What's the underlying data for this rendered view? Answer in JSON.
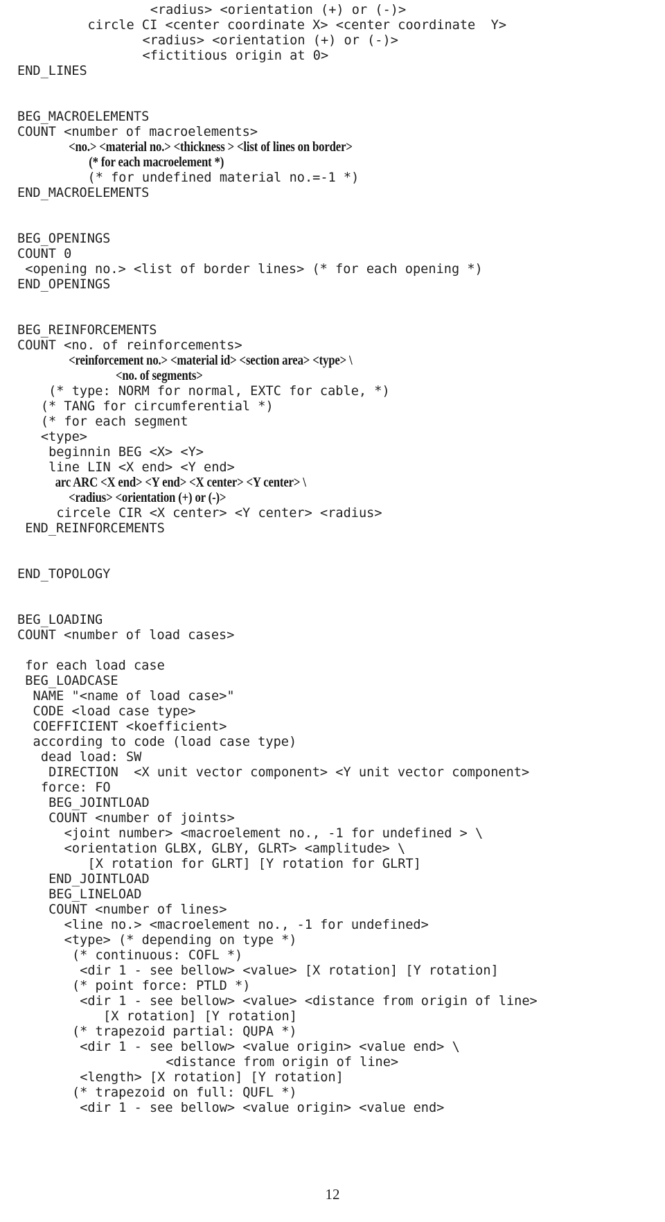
{
  "document": {
    "page_number": "12",
    "lines": [
      {
        "indent": 17,
        "text": "<radius> <orientation (+) or (-)>",
        "style": "mono"
      },
      {
        "indent": 9,
        "text": "circle CI <center coordinate X> <center coordinate  Y>",
        "style": "mono"
      },
      {
        "indent": 16,
        "text": "<radius> <orientation (+) or (-)>",
        "style": "mono"
      },
      {
        "indent": 16,
        "text": "<fictitious origin at 0>",
        "style": "mono"
      },
      {
        "indent": 0,
        "text": "END_LINES",
        "style": "mono"
      },
      {
        "indent": 0,
        "text": "",
        "style": "blank"
      },
      {
        "indent": 0,
        "text": "",
        "style": "blank"
      },
      {
        "indent": 0,
        "text": "BEG_MACROELEMENTS",
        "style": "mono"
      },
      {
        "indent": 0,
        "text": "COUNT <number of macroelements>",
        "style": "mono"
      },
      {
        "indent": 8,
        "text": "<no.> <material no.> <thickness > <list of lines on border>",
        "style": "serif"
      },
      {
        "indent": 11,
        "text": "(* for each macroelement *)",
        "style": "serif"
      },
      {
        "indent": 9,
        "text": "(* for undefined material no.=-1 *)",
        "style": "mono"
      },
      {
        "indent": 0,
        "text": "END_MACROELEMENTS",
        "style": "mono"
      },
      {
        "indent": 0,
        "text": "",
        "style": "blank"
      },
      {
        "indent": 0,
        "text": "",
        "style": "blank"
      },
      {
        "indent": 0,
        "text": "BEG_OPENINGS",
        "style": "mono"
      },
      {
        "indent": 0,
        "text": "COUNT 0",
        "style": "mono"
      },
      {
        "indent": 1,
        "text": "<opening no.> <list of border lines> (* for each opening *)",
        "style": "mono"
      },
      {
        "indent": 0,
        "text": "END_OPENINGS",
        "style": "mono"
      },
      {
        "indent": 0,
        "text": "",
        "style": "blank"
      },
      {
        "indent": 0,
        "text": "",
        "style": "blank"
      },
      {
        "indent": 0,
        "text": "BEG_REINFORCEMENTS",
        "style": "mono"
      },
      {
        "indent": 0,
        "text": "COUNT <no. of reinforcements>",
        "style": "mono"
      },
      {
        "indent": 8,
        "text": "<reinforcement no.> <material id> <section area> <type> \\",
        "style": "serif"
      },
      {
        "indent": 15,
        "text": "<no. of segments>",
        "style": "serif"
      },
      {
        "indent": 4,
        "text": "(* type: NORM for normal, EXTC for cable, *)",
        "style": "mono"
      },
      {
        "indent": 3,
        "text": "(* TANG for circumferential *)",
        "style": "mono"
      },
      {
        "indent": 3,
        "text": "(* for each segment",
        "style": "mono"
      },
      {
        "indent": 3,
        "text": "<type>",
        "style": "mono"
      },
      {
        "indent": 4,
        "text": "beginnin BEG <X> <Y>",
        "style": "mono"
      },
      {
        "indent": 4,
        "text": "line LIN <X end> <Y end>",
        "style": "mono"
      },
      {
        "indent": 6,
        "text": "arc ARC <X end> <Y end> <X center> <Y center> \\",
        "style": "serif"
      },
      {
        "indent": 8,
        "text": "<radius> <orientation (+) or (-)>",
        "style": "serif"
      },
      {
        "indent": 5,
        "text": "circele CIR <X center> <Y center> <radius>",
        "style": "mono"
      },
      {
        "indent": 1,
        "text": "END_REINFORCEMENTS",
        "style": "mono"
      },
      {
        "indent": 0,
        "text": "",
        "style": "blank"
      },
      {
        "indent": 0,
        "text": "",
        "style": "blank"
      },
      {
        "indent": 0,
        "text": "END_TOPOLOGY",
        "style": "mono"
      },
      {
        "indent": 0,
        "text": "",
        "style": "blank"
      },
      {
        "indent": 0,
        "text": "",
        "style": "blank"
      },
      {
        "indent": 0,
        "text": "BEG_LOADING",
        "style": "mono"
      },
      {
        "indent": 0,
        "text": "COUNT <number of load cases>",
        "style": "mono"
      },
      {
        "indent": 0,
        "text": "",
        "style": "blank"
      },
      {
        "indent": 1,
        "text": "for each load case",
        "style": "mono"
      },
      {
        "indent": 1,
        "text": "BEG_LOADCASE",
        "style": "mono"
      },
      {
        "indent": 2,
        "text": "NAME \"<name of load case>\"",
        "style": "mono"
      },
      {
        "indent": 2,
        "text": "CODE <load case type>",
        "style": "mono"
      },
      {
        "indent": 2,
        "text": "COEFFICIENT <koefficient>",
        "style": "mono"
      },
      {
        "indent": 2,
        "text": "according to code (load case type)",
        "style": "mono"
      },
      {
        "indent": 3,
        "text": "dead load: SW",
        "style": "mono"
      },
      {
        "indent": 4,
        "text": "DIRECTION  <X unit vector component> <Y unit vector component>",
        "style": "mono"
      },
      {
        "indent": 3,
        "text": "force: FO",
        "style": "mono"
      },
      {
        "indent": 4,
        "text": "BEG_JOINTLOAD",
        "style": "mono"
      },
      {
        "indent": 4,
        "text": "COUNT <number of joints>",
        "style": "mono"
      },
      {
        "indent": 6,
        "text": "<joint number> <macroelement no., -1 for undefined > \\",
        "style": "mono"
      },
      {
        "indent": 6,
        "text": "<orientation GLBX, GLBY, GLRT> <amplitude> \\",
        "style": "mono"
      },
      {
        "indent": 9,
        "text": "[X rotation for GLRT] [Y rotation for GLRT]",
        "style": "mono"
      },
      {
        "indent": 4,
        "text": "END_JOINTLOAD",
        "style": "mono"
      },
      {
        "indent": 4,
        "text": "BEG_LINELOAD",
        "style": "mono"
      },
      {
        "indent": 4,
        "text": "COUNT <number of lines>",
        "style": "mono"
      },
      {
        "indent": 6,
        "text": "<line no.> <macroelement no., -1 for undefined>",
        "style": "mono"
      },
      {
        "indent": 6,
        "text": "<type> (* depending on type *)",
        "style": "mono"
      },
      {
        "indent": 7,
        "text": "(* continuous: COFL *)",
        "style": "mono"
      },
      {
        "indent": 8,
        "text": "<dir 1 - see bellow> <value> [X rotation] [Y rotation]",
        "style": "mono"
      },
      {
        "indent": 7,
        "text": "(* point force: PTLD *)",
        "style": "mono"
      },
      {
        "indent": 8,
        "text": "<dir 1 - see bellow> <value> <distance from origin of line>",
        "style": "mono"
      },
      {
        "indent": 11,
        "text": "[X rotation] [Y rotation]",
        "style": "mono"
      },
      {
        "indent": 7,
        "text": "(* trapezoid partial: QUPA *)",
        "style": "mono"
      },
      {
        "indent": 8,
        "text": "<dir 1 - see bellow> <value origin> <value end> \\",
        "style": "mono"
      },
      {
        "indent": 19,
        "text": "<distance from origin of line>",
        "style": "mono"
      },
      {
        "indent": 8,
        "text": "<length> [X rotation] [Y rotation]",
        "style": "mono"
      },
      {
        "indent": 7,
        "text": "(* trapezoid on full: QUFL *)",
        "style": "mono"
      },
      {
        "indent": 8,
        "text": "<dir 1 - see bellow> <value origin> <value end>",
        "style": "mono"
      }
    ]
  }
}
